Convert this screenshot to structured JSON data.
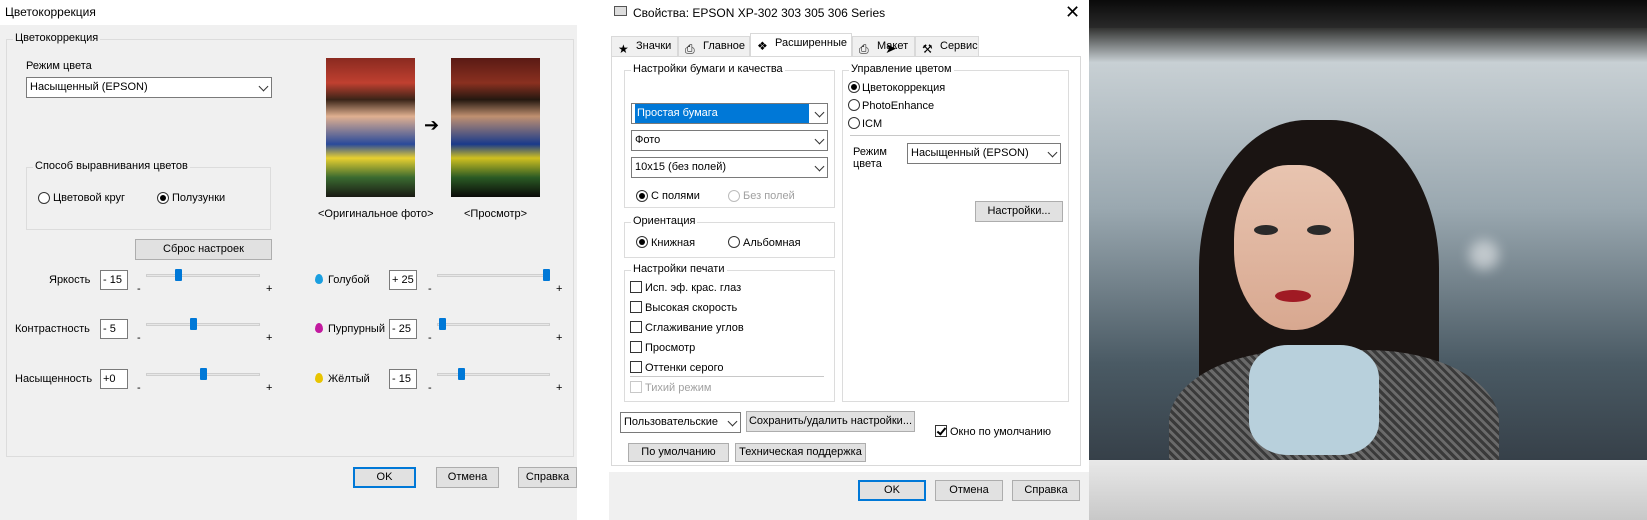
{
  "left_dialog": {
    "title": "Цветокоррекция",
    "group_title": "Цветокоррекция",
    "color_mode_label": "Режим цвета",
    "color_mode_value": "Насыщенный (EPSON)",
    "align_group_title": "Способ выравнивания цветов",
    "radio_wheel": "Цветовой круг",
    "radio_sliders": "Полузунки",
    "reset_button": "Сброс настроек",
    "caption_original": "<Оригинальное фото>",
    "caption_preview": "<Просмотр>",
    "arrow_icon": "arrow-right-icon",
    "sliders_left": [
      {
        "label": "Яркость",
        "value": "- 15",
        "level": 0.27
      },
      {
        "label": "Контрастность",
        "value": "- 5",
        "level": 0.41
      },
      {
        "label": "Насыщенность",
        "value": "+0",
        "level": 0.5
      }
    ],
    "sliders_right": [
      {
        "label": "Голубой",
        "value": "+ 25",
        "level": 1.0,
        "drop_color": "#1a9fe0"
      },
      {
        "label": "Пурпурный",
        "value": "- 25",
        "level": 0.02,
        "drop_color": "#c21a9f"
      },
      {
        "label": "Жёлтый",
        "value": "- 15",
        "level": 0.2,
        "drop_color": "#e8c400"
      }
    ],
    "minus": "-",
    "plus": "+",
    "ok": "OK",
    "cancel": "Отмена",
    "help": "Справка"
  },
  "props_dialog": {
    "title": "Свойства: EPSON XP-302 303 305 306 Series",
    "close_icon": "close-icon",
    "tabs": [
      {
        "label": "Значки",
        "icon": "star-icon"
      },
      {
        "label": "Главное",
        "icon": "printer-icon"
      },
      {
        "label": "Расширенные",
        "icon": "advanced-icon"
      },
      {
        "label": "Макет",
        "icon": "layout-icon"
      },
      {
        "label": "Сервис",
        "icon": "wrench-icon"
      }
    ],
    "paper_group": "Настройки бумаги и качества",
    "paper_type": "Простая бумага",
    "quality": "Фото",
    "size": "10x15 (без полей)",
    "radio_margins": "С полями",
    "radio_borderless": "Без полей",
    "orientation_group": "Ориентация",
    "portrait": "Книжная",
    "landscape": "Альбомная",
    "print_group": "Настройки печати",
    "print_options": [
      {
        "label": "Исп. эф. крас. глаз",
        "disabled": false
      },
      {
        "label": "Высокая скорость",
        "disabled": false
      },
      {
        "label": "Сглаживание углов",
        "disabled": false
      },
      {
        "label": "Просмотр",
        "disabled": false
      },
      {
        "label": "Оттенки серого",
        "disabled": false
      },
      {
        "label": "Тихий режим",
        "disabled": true
      }
    ],
    "color_group": "Управление цветом",
    "color_options": [
      "Цветокоррекция",
      "PhotoEnhance",
      "ICM"
    ],
    "mode_label": "Режим\nцвета",
    "mode_value": "Насыщенный (EPSON)",
    "settings_button": "Настройки...",
    "preset_value": "Пользовательские",
    "save_button": "Сохранить/удалить настройки...",
    "default_window": "Окно по умолчанию",
    "defaults_button": "По умолчанию",
    "support_button": "Техническая поддержка",
    "ok": "OK",
    "cancel": "Отмена",
    "help": "Справка"
  },
  "colors": {
    "accent": "#0078d7",
    "dialog_bg": "#f0f0f0"
  }
}
